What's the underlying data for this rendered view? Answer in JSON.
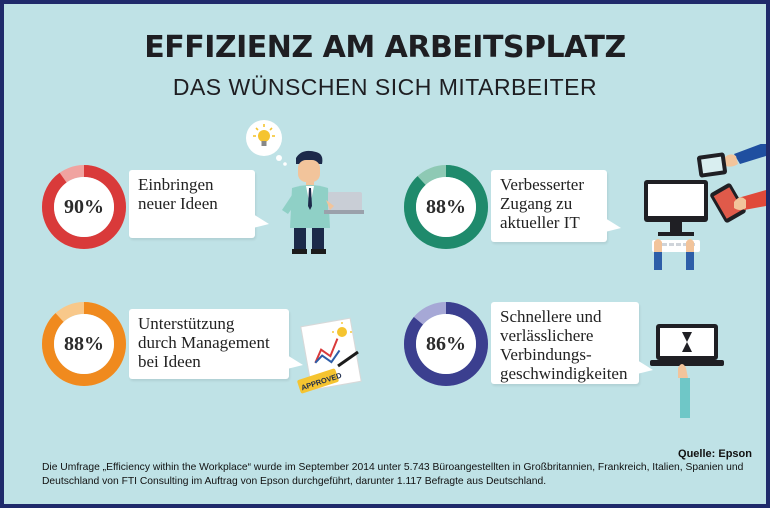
{
  "title": "EFFIZIENZ AM ARBEITSPLATZ",
  "subtitle": "DAS WÜNSCHEN SICH MITARBEITER",
  "chart_data": {
    "type": "pie",
    "items": [
      {
        "label": "Einbringen\nneuer Ideen",
        "value": 90,
        "display": "90%",
        "color": "#d93a3a",
        "light": "#f0a3a0"
      },
      {
        "label": "Verbesserter\nZugang zu\naktueller IT",
        "value": 88,
        "display": "88%",
        "color": "#1f8a6c",
        "light": "#8ec9b4"
      },
      {
        "label": "Unterstützung\ndurch Management\nbei Ideen",
        "value": 88,
        "display": "88%",
        "color": "#f08a1e",
        "light": "#f8c88a"
      },
      {
        "label": "Schnellere und\nverlässlichere\nVerbindungs-\ngeschwindigkeiten",
        "value": 86,
        "display": "86%",
        "color": "#3b3f8f",
        "light": "#a6a8d6"
      }
    ]
  },
  "illustrations": {
    "lightbulb": "lightbulb-icon",
    "worker": "businessman-laptop-icon",
    "computer": "desktop-computer-icon",
    "devices": "tablet-phone-hands-icon",
    "document": "approved-document-icon",
    "approved_stamp": "APPROVED",
    "laptop": "laptop-hourglass-icon"
  },
  "source": "Quelle: Epson",
  "footnote": "Die Umfrage „Efficiency within the Workplace“ wurde im September 2014 unter 5.743 Büroangestellten in Großbritannien, Frankreich, Italien, Spanien und Deutschland von FTI Consulting im Auftrag von Epson durchgeführt, darunter 1.117 Befragte aus Deutschland."
}
